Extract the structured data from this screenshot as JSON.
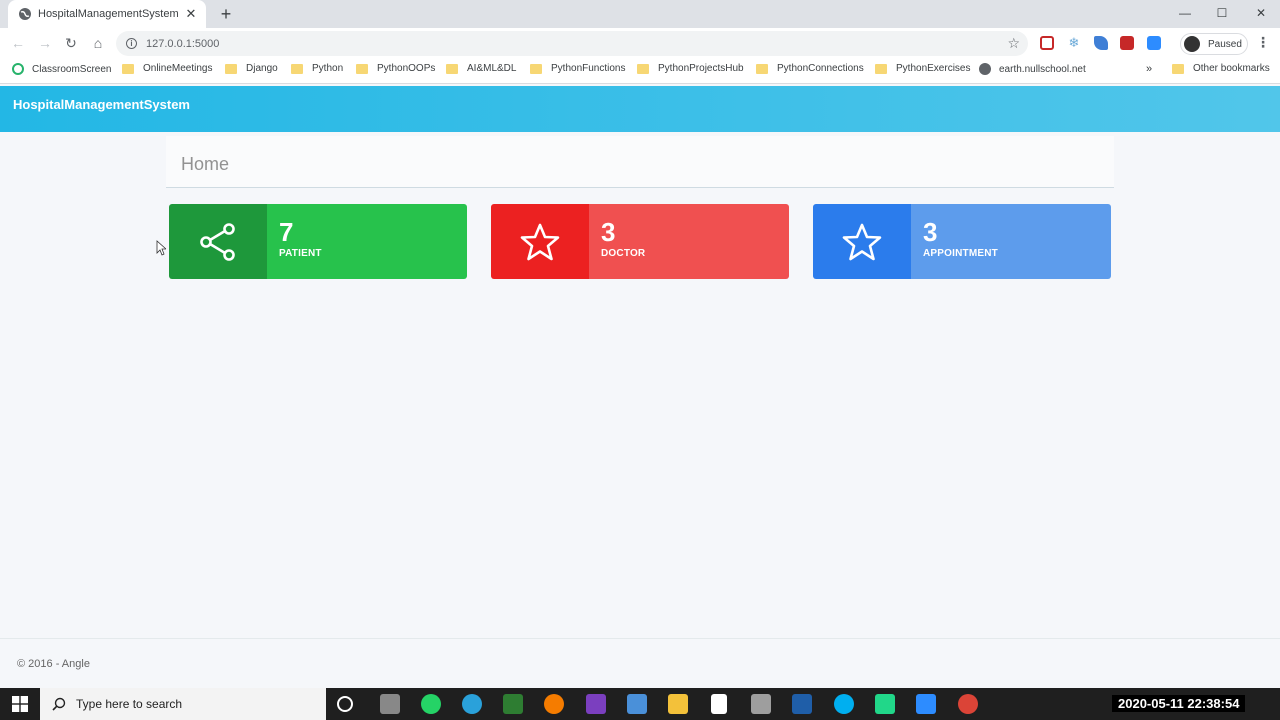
{
  "browser": {
    "tab_title": "HospitalManagementSystem",
    "tab_close": "✕",
    "new_tab": "+",
    "url": "127.0.0.1:5000",
    "profile_status": "Paused",
    "window_controls": {
      "minimize": "—",
      "maximize": "☐",
      "close": "✕"
    },
    "bookmarks": [
      {
        "label": "ClassroomScreen",
        "icon": "classroomscreen-icon"
      },
      {
        "label": "OnlineMeetings",
        "icon": "folder-icon"
      },
      {
        "label": "Django",
        "icon": "folder-icon"
      },
      {
        "label": "Python",
        "icon": "folder-icon"
      },
      {
        "label": "PythonOOPs",
        "icon": "folder-icon"
      },
      {
        "label": "AI&ML&DL",
        "icon": "folder-icon"
      },
      {
        "label": "PythonFunctions",
        "icon": "folder-icon"
      },
      {
        "label": "PythonProjectsHub",
        "icon": "folder-icon"
      },
      {
        "label": "PythonConnections",
        "icon": "folder-icon"
      },
      {
        "label": "PythonExercises",
        "icon": "folder-icon"
      },
      {
        "label": "earth.nullschool.net",
        "icon": "globe-icon"
      }
    ],
    "bookmarks_more": "»",
    "other_bookmarks": "Other bookmarks"
  },
  "app": {
    "brand": "HospitalManagementSystem",
    "page_title": "Home",
    "cards": [
      {
        "value": "7",
        "label": "PATIENT",
        "icon": "share-icon",
        "icon_bg": "#1e983b",
        "bg": "#27c24c"
      },
      {
        "value": "3",
        "label": "DOCTOR",
        "icon": "star-icon",
        "icon_bg": "#ec2121",
        "bg": "#f05050"
      },
      {
        "value": "3",
        "label": "APPOINTMENT",
        "icon": "star-icon",
        "icon_bg": "#2b7cec",
        "bg": "#5d9cec"
      }
    ],
    "footer": "© 2016 - Angle"
  },
  "taskbar": {
    "search_placeholder": "Type here to search",
    "clock": "2020-05-11  22:38:54"
  }
}
